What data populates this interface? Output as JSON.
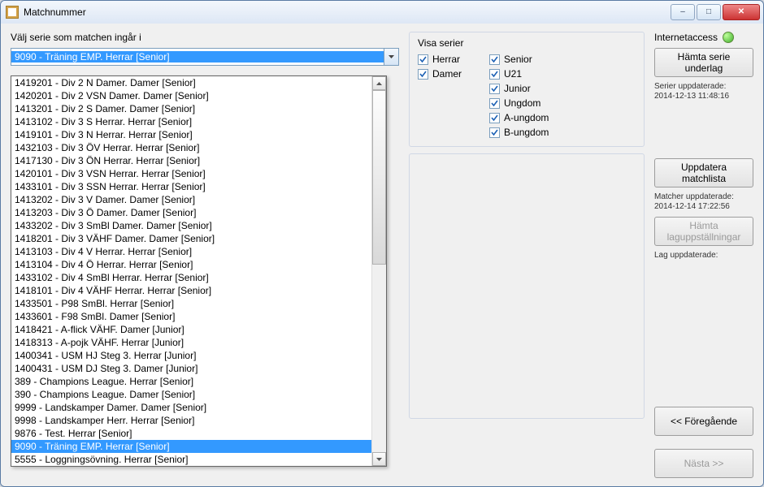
{
  "window": {
    "title": "Matchnummer"
  },
  "labels": {
    "choose_series": "Välj serie som matchen ingår i",
    "show_series": "Visa serier",
    "internet_access": "Internetaccess"
  },
  "combo": {
    "selected": "9090 - Träning EMP. Herrar [Senior]"
  },
  "dropdown": {
    "highlight_index": 28,
    "items": [
      "1419201 - Div 2 N Damer. Damer [Senior]",
      "1420201 - Div 2 VSN Damer. Damer [Senior]",
      "1413201 - Div 2 S Damer. Damer [Senior]",
      "1413102 - Div 3 S Herrar. Herrar [Senior]",
      "1419101 - Div 3 N Herrar. Herrar [Senior]",
      "1432103 - Div 3 ÖV Herrar. Herrar [Senior]",
      "1417130 - Div 3 ÖN Herrar. Herrar [Senior]",
      "1420101 - Div 3 VSN Herrar. Herrar [Senior]",
      "1433101 - Div 3 SSN Herrar. Herrar [Senior]",
      "1413202 - Div 3 V Damer. Damer [Senior]",
      "1413203 - Div 3 Ö Damer. Damer [Senior]",
      "1433202 - Div 3 SmBl Damer. Damer [Senior]",
      "1418201 - Div 3 VÄHF Damer. Damer [Senior]",
      "1413103 - Div 4 V Herrar. Herrar [Senior]",
      "1413104 - Div 4 Ö Herrar. Herrar [Senior]",
      "1433102 - Div 4 SmBl Herrar. Herrar [Senior]",
      "1418101 - Div 4 VÄHF Herrar. Herrar [Senior]",
      "1433501 - P98 SmBl. Herrar [Senior]",
      "1433601 - F98 SmBl. Damer [Senior]",
      "1418421 - A-flick VÄHF. Damer [Junior]",
      "1418313 - A-pojk VÄHF. Herrar [Junior]",
      "1400341 - USM HJ Steg 3. Herrar [Junior]",
      "1400431 - USM DJ Steg 3. Damer [Junior]",
      "389 - Champions League. Herrar [Senior]",
      "390 - Champions League. Damer [Senior]",
      "9999 - Landskamper Damer. Damer [Senior]",
      "9998 - Landskamper Herr. Herrar [Senior]",
      "9876 - Test. Herrar [Senior]",
      "9090 - Träning EMP. Herrar [Senior]",
      "5555 - Loggningsövning. Herrar [Senior]"
    ]
  },
  "checkboxes": {
    "left": [
      {
        "label": "Herrar",
        "checked": true
      },
      {
        "label": "Damer",
        "checked": true
      }
    ],
    "right": [
      {
        "label": "Senior",
        "checked": true
      },
      {
        "label": "U21",
        "checked": true
      },
      {
        "label": "Junior",
        "checked": true
      },
      {
        "label": "Ungdom",
        "checked": true
      },
      {
        "label": "A-ungdom",
        "checked": true
      },
      {
        "label": "B-ungdom",
        "checked": true
      }
    ]
  },
  "buttons": {
    "fetch_series": "Hämta serie underlag",
    "update_matchlist": "Uppdatera matchlista",
    "fetch_lineups": "Hämta laguppställningar",
    "prev": "<< Föregående",
    "next": "Nästa >>"
  },
  "status": {
    "series_updated_label": "Serier uppdaterade:",
    "series_updated_value": "2014-12-13 11:48:16",
    "matches_updated_label": "Matcher uppdaterade:",
    "matches_updated_value": "2014-12-14 17:22:56",
    "teams_updated_label": "Lag uppdaterade:"
  }
}
